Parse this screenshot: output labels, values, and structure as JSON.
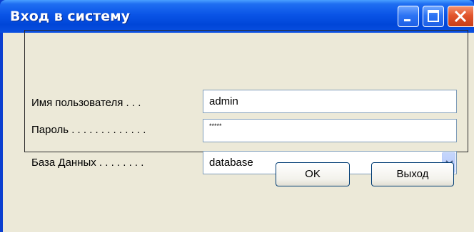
{
  "window": {
    "title": "Вход в систему",
    "controls": [
      "minimize-icon",
      "maximize-icon",
      "close-icon"
    ]
  },
  "form": {
    "username_label": "Имя пользователя . . .",
    "username_value": "admin",
    "password_label": "Пароль . . . . . . . . . . . . .",
    "password_value": "*****",
    "database_label": "База Данных . . . . . . . .",
    "database_value": "database"
  },
  "buttons": {
    "ok_label": "OK",
    "exit_label": "Выход"
  },
  "colors": {
    "titlebar": "#0046d8",
    "client": "#ece9d8",
    "close_button": "#e2552c"
  }
}
